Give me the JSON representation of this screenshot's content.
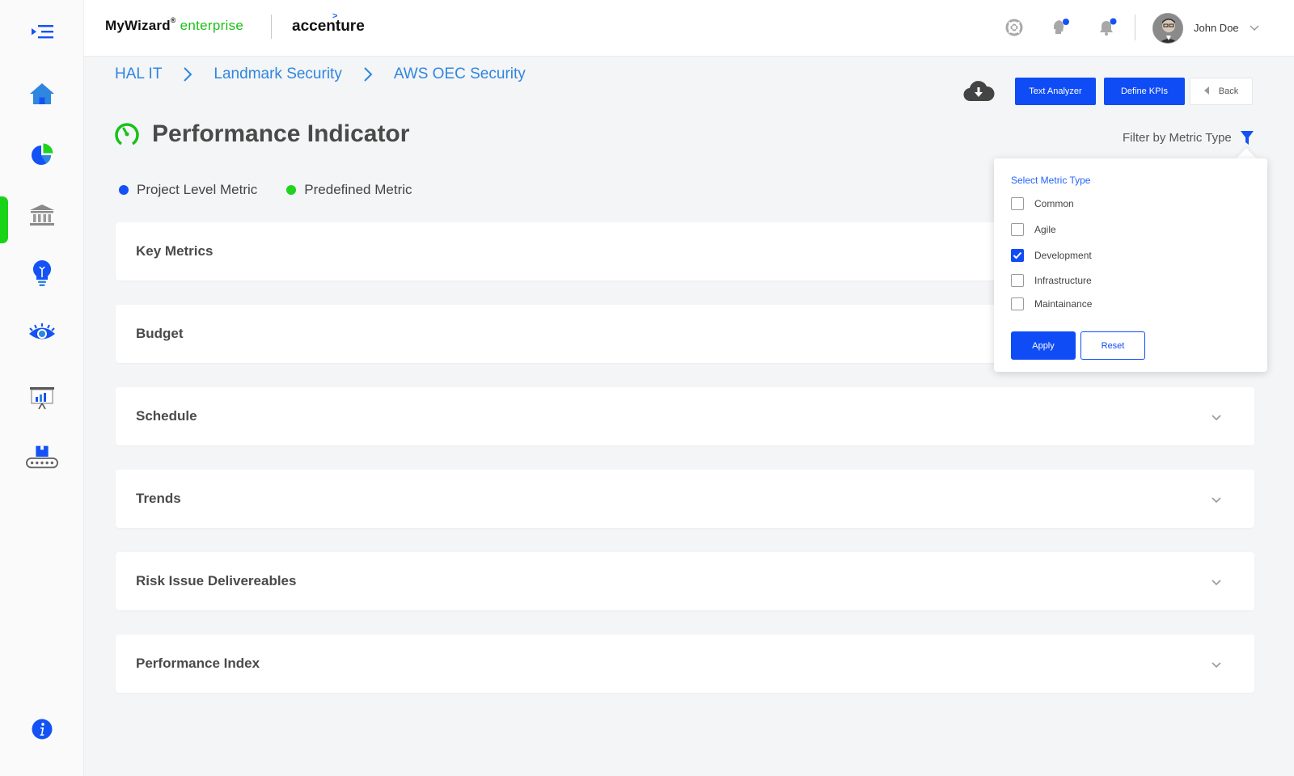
{
  "header": {
    "brand_name": "MyWizard",
    "brand_reg": "®",
    "brand_suffix": "enterprise",
    "partner": "accenture",
    "partner_mark": ">",
    "user_name": "John Doe"
  },
  "sidebar": {
    "items": [
      {
        "icon": "menu-toggle-icon"
      },
      {
        "icon": "home-icon"
      },
      {
        "icon": "pie-chart-icon"
      },
      {
        "icon": "bank-icon",
        "active": true
      },
      {
        "icon": "lightbulb-icon"
      },
      {
        "icon": "eye-icon"
      },
      {
        "icon": "presentation-chart-icon"
      },
      {
        "icon": "conveyor-icon"
      },
      {
        "icon": "info-icon"
      }
    ]
  },
  "breadcrumb": {
    "items": [
      "HAL IT",
      "Landmark Security",
      "AWS OEC Security"
    ]
  },
  "toolbar": {
    "text_analyzer": "Text Analyzer",
    "define_kpis": "Define KPIs",
    "back": "Back"
  },
  "page": {
    "title": "Performance Indicator",
    "filter_label": "Filter by Metric Type"
  },
  "legend": [
    {
      "label": "Project Level Metric",
      "color": "#1452f5"
    },
    {
      "label": "Predefined Metric",
      "color": "#1fd31f"
    }
  ],
  "panels": [
    {
      "title": "Key Metrics"
    },
    {
      "title": "Budget"
    },
    {
      "title": "Schedule"
    },
    {
      "title": "Trends"
    },
    {
      "title": "Risk Issue Delivereables"
    },
    {
      "title": "Performance Index"
    }
  ],
  "filter_dropdown": {
    "heading": "Select Metric Type",
    "options": [
      {
        "label": "Common",
        "checked": false
      },
      {
        "label": "Agile",
        "checked": false
      },
      {
        "label": "Development",
        "checked": true
      },
      {
        "label": "Infrastructure",
        "checked": false
      },
      {
        "label": "Maintainance",
        "checked": false
      }
    ],
    "apply": "Apply",
    "reset": "Reset"
  },
  "colors": {
    "primary": "#0f4cf5",
    "accent_green": "#19d319",
    "link": "#2f86e0"
  }
}
